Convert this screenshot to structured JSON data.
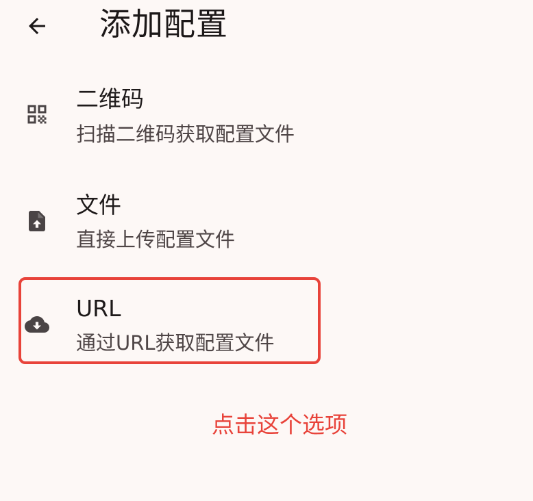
{
  "header": {
    "title": "添加配置",
    "back_icon": "arrow-back-icon"
  },
  "options": [
    {
      "title": "二维码",
      "subtitle": "扫描二维码获取配置文件",
      "icon": "qr-code-icon"
    },
    {
      "title": "文件",
      "subtitle": "直接上传配置文件",
      "icon": "file-upload-icon"
    },
    {
      "title": "URL",
      "subtitle": "通过URL获取配置文件",
      "icon": "cloud-download-icon"
    }
  ],
  "annotation": {
    "hint": "点击这个选项",
    "color": "#e8433a"
  },
  "colors": {
    "background": "#fdf8f6",
    "icon": "#4a4445"
  }
}
